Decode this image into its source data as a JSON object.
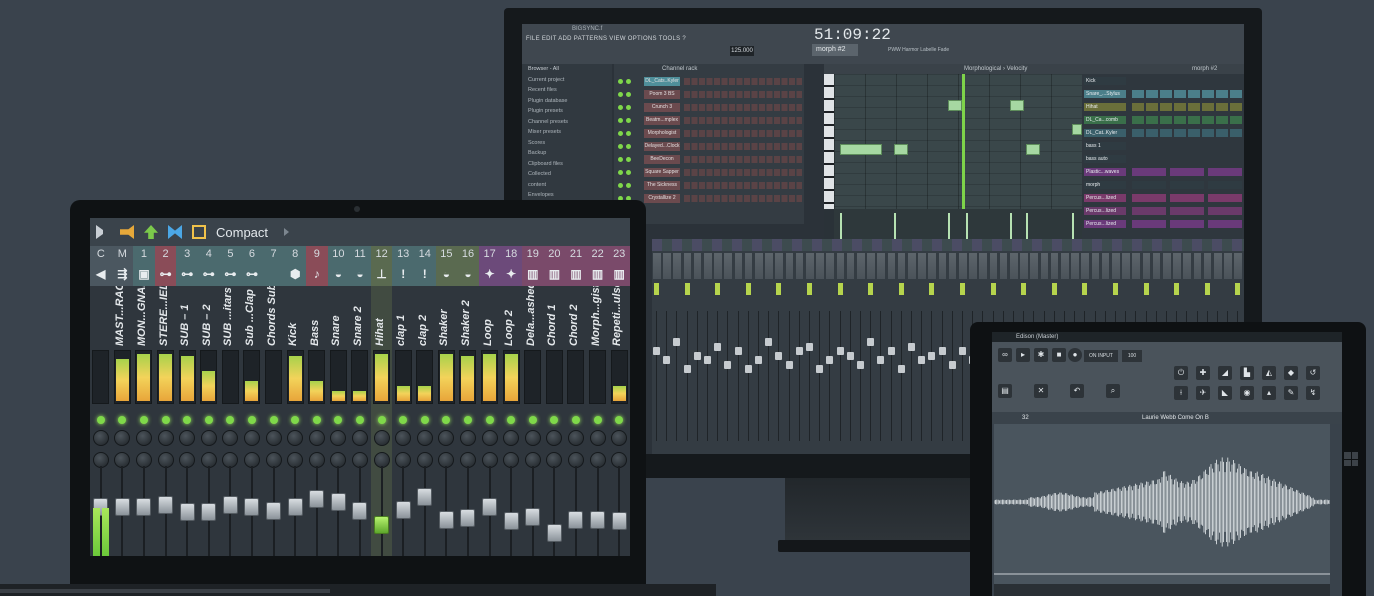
{
  "laptop": {
    "toolbar": {
      "view_label": "Compact"
    },
    "channels": [
      {
        "num": "C",
        "icon": "◀",
        "name": "",
        "color": "#4b5760",
        "level": 0.0,
        "fader": 0.55
      },
      {
        "num": "M",
        "icon": "⇶",
        "name": "MAST...RACK",
        "color": "#4b5760",
        "level": 0.85,
        "fader": 0.55
      },
      {
        "num": "1",
        "icon": "▣",
        "name": "MON...GNAL",
        "color": "#4b6a6e",
        "level": 0.95,
        "fader": 0.55
      },
      {
        "num": "2",
        "icon": "⊶",
        "name": "STERE...IELD",
        "color": "#8a4c58",
        "level": 0.95,
        "fader": 0.58
      },
      {
        "num": "3",
        "icon": "⊶",
        "name": "SUB – 1",
        "color": "#4b6a6e",
        "level": 0.9,
        "fader": 0.48
      },
      {
        "num": "4",
        "icon": "⊶",
        "name": "SUB – 2",
        "color": "#4b6a6e",
        "level": 0.6,
        "fader": 0.48
      },
      {
        "num": "5",
        "icon": "⊶",
        "name": "SUB ...itars",
        "color": "#4b6a6e",
        "level": 0.0,
        "fader": 0.58
      },
      {
        "num": "6",
        "icon": "⊶",
        "name": "Sub ...Clap",
        "color": "#4b6a6e",
        "level": 0.4,
        "fader": 0.55
      },
      {
        "num": "7",
        "icon": "",
        "name": "Chords Sub",
        "color": "#4b6a6e",
        "level": 0.0,
        "fader": 0.5
      },
      {
        "num": "8",
        "icon": "⬢",
        "name": "Kick",
        "color": "#4b6a6e",
        "level": 0.9,
        "fader": 0.56
      },
      {
        "num": "9",
        "icon": "♪",
        "name": "Bass",
        "color": "#8a4c58",
        "level": 0.4,
        "fader": 0.66
      },
      {
        "num": "10",
        "icon": "◒",
        "name": "Snare",
        "color": "#4b6a6e",
        "level": 0.2,
        "fader": 0.62
      },
      {
        "num": "11",
        "icon": "◒",
        "name": "Snare 2",
        "color": "#4b6a6e",
        "level": 0.2,
        "fader": 0.5
      },
      {
        "num": "12",
        "icon": "⊥",
        "name": "Hihat",
        "color": "#5a6a50",
        "level": 0.95,
        "fader": 0.3
      },
      {
        "num": "13",
        "icon": "!",
        "name": "clap 1",
        "color": "#4b6a6e",
        "level": 0.3,
        "fader": 0.52
      },
      {
        "num": "14",
        "icon": "!",
        "name": "clap 2",
        "color": "#4b6a6e",
        "level": 0.3,
        "fader": 0.7
      },
      {
        "num": "15",
        "icon": "◒",
        "name": "Shaker",
        "color": "#5a6a50",
        "level": 0.95,
        "fader": 0.38
      },
      {
        "num": "16",
        "icon": "◒",
        "name": "Shaker 2",
        "color": "#5a6a50",
        "level": 0.9,
        "fader": 0.4
      },
      {
        "num": "17",
        "icon": "✦",
        "name": "Loop",
        "color": "#6c4a7a",
        "level": 0.95,
        "fader": 0.55
      },
      {
        "num": "18",
        "icon": "✦",
        "name": "Loop 2",
        "color": "#6c4a7a",
        "level": 0.95,
        "fader": 0.36
      },
      {
        "num": "19",
        "icon": "▥",
        "name": "Dela...ashed",
        "color": "#7a4a6a",
        "level": 0.0,
        "fader": 0.42
      },
      {
        "num": "20",
        "icon": "▥",
        "name": "Chord 1",
        "color": "#7a4a6a",
        "level": 0.0,
        "fader": 0.2
      },
      {
        "num": "21",
        "icon": "▥",
        "name": "Chord 2",
        "color": "#7a4a6a",
        "level": 0.0,
        "fader": 0.38
      },
      {
        "num": "22",
        "icon": "▥",
        "name": "Morph...gist",
        "color": "#7a4a6a",
        "level": 0.0,
        "fader": 0.38
      },
      {
        "num": "23",
        "icon": "▥",
        "name": "Repeti...ulse",
        "color": "#7a4a6a",
        "level": 0.3,
        "fader": 0.36
      }
    ]
  },
  "monitor": {
    "title": "BIGSYNC.f",
    "menu": "FILE  EDIT  ADD  PATTERNS  VIEW  OPTIONS  TOOLS  ?",
    "time": "51:09:22",
    "tempo": "125.000",
    "pattern": "morph #2",
    "hint": "PWW Harmor Labelle Fade",
    "browser": {
      "header": "Browser - All",
      "items": [
        "Current project",
        "Recent files",
        "Plugin database",
        "Plugin presets",
        "Channel presets",
        "Mixer presets",
        "Scores",
        "Backup",
        "Clipboard files",
        "Collected",
        "content",
        "Envelopes"
      ]
    },
    "channel_rack": {
      "title": "Channel rack",
      "channels": [
        "DL_Cats..Kyler",
        "Poom 3 BS",
        "Crunch 3",
        "Beatm...mplex",
        "Morphologist",
        "Delayed...Clock",
        "BeeDecon",
        "Square Sapper",
        "The Sickness",
        "Crystallize 2"
      ]
    },
    "piano_roll": {
      "title": "Morphological › Velocity"
    },
    "playlist": {
      "title": "morph #2",
      "tracks": [
        {
          "name": "Kick",
          "color": "#2f3b42"
        },
        {
          "name": "Snare_...Stylus",
          "color": "#4b7f8a"
        },
        {
          "name": "Hihat",
          "color": "#6a6f3a"
        },
        {
          "name": "DL_Ca...comb",
          "color": "#3a6f4a"
        },
        {
          "name": "DL_Cat..Kyler",
          "color": "#3a5f6a"
        },
        {
          "name": "bass 1",
          "color": "#2f3b42"
        },
        {
          "name": "bass auto",
          "color": "#2f3b42"
        },
        {
          "name": "Plastic...waves",
          "color": "#6a3a7a"
        },
        {
          "name": "morph",
          "color": "#2f3b42"
        },
        {
          "name": "Percus...lized",
          "color": "#7a3a6a"
        },
        {
          "name": "Percus...lized",
          "color": "#6a3a6a"
        },
        {
          "name": "Percus...lized",
          "color": "#6a3a7a"
        }
      ]
    }
  },
  "tablet": {
    "title": "Edison (Master)",
    "input": "ON INPUT",
    "tempo": "100",
    "bars": "32",
    "sample": "Laurie Webb Come On B"
  }
}
